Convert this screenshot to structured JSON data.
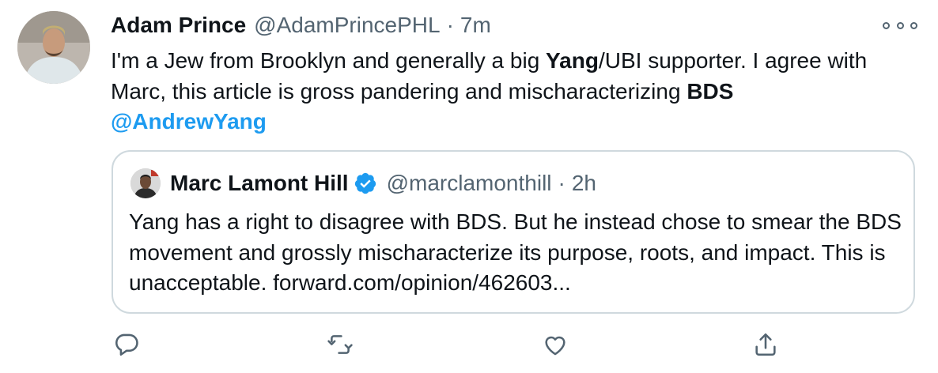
{
  "tweet": {
    "author_name": "Adam Prince",
    "author_handle": "@AdamPrincePHL",
    "separator": "·",
    "time": "7m",
    "text": {
      "part1": "I'm a Jew from Brooklyn and generally a big ",
      "bold1": "Yang",
      "part2": "/UBI supporter.  I agree with Marc, this article is gross pandering and mischaracterizing ",
      "bold2": "BDS",
      "mention": "@AndrewYang"
    }
  },
  "quoted_tweet": {
    "author_name": "Marc Lamont Hill",
    "author_handle": "@marclamonthill",
    "separator": "·",
    "time": "2h",
    "text": "Yang has a right to disagree with BDS.  But he instead chose to smear the BDS movement and grossly mischaracterize its purpose, roots, and impact. This is unacceptable.  ",
    "link_text": "forward.com/opinion/462603..."
  },
  "icons": {
    "more": "more-horizontal-icon",
    "reply": "reply-icon",
    "retweet": "retweet-icon",
    "like": "heart-icon",
    "share": "share-icon",
    "verified": "verified-badge-icon"
  },
  "colors": {
    "text": "#0f1419",
    "secondary": "#536471",
    "accent": "#1d9bf0",
    "border": "#cfd9de"
  }
}
